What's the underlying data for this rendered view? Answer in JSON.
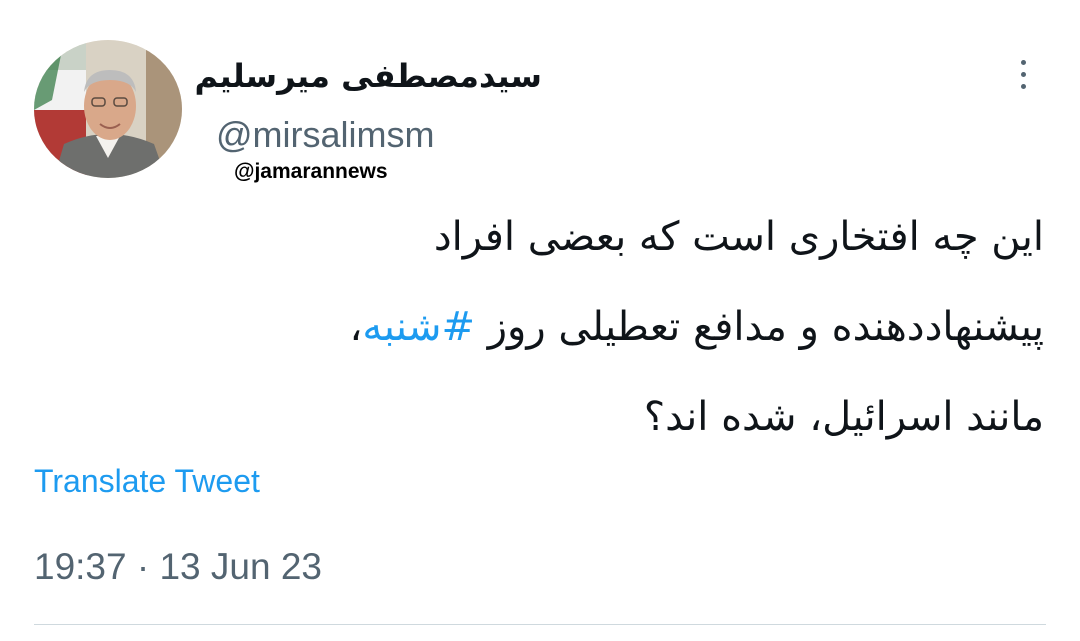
{
  "author": {
    "display_name": "سیدمصطفی میرسلیم",
    "handle": "@mirsalimsm"
  },
  "watermark": "@jamarannews",
  "tweet": {
    "line1": "این چه افتخاری است که بعضی افراد",
    "line2_before": "پیشنهاددهنده و مدافع تعطیلی روز ",
    "hashtag": "#شنبه",
    "line2_after": "،",
    "line3": "مانند اسرائیل،  شده اند؟"
  },
  "translate_label": "Translate Tweet",
  "timestamp": "19:37 · 13 Jun 23",
  "colors": {
    "link": "#1d9bf0",
    "secondary_text": "#536471",
    "primary_text": "#0f1419",
    "divider": "#cfd9de"
  },
  "icons": {
    "more": "more-vertical-icon"
  }
}
